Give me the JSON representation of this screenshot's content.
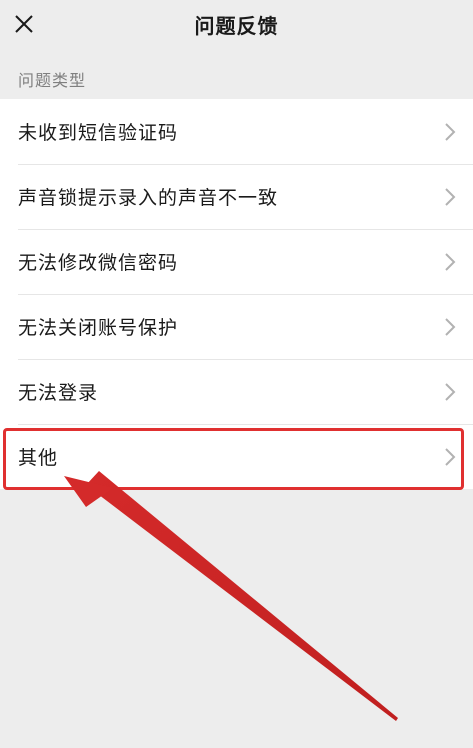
{
  "header": {
    "title": "问题反馈",
    "close_icon": "close-icon"
  },
  "section": {
    "label": "问题类型"
  },
  "items": [
    {
      "label": "未收到短信验证码"
    },
    {
      "label": "声音锁提示录入的声音不一致"
    },
    {
      "label": "无法修改微信密码"
    },
    {
      "label": "无法关闭账号保护"
    },
    {
      "label": "无法登录"
    },
    {
      "label": "其他"
    }
  ],
  "annotation": {
    "highlight_color": "#e03030",
    "highlighted_item": "其他"
  }
}
